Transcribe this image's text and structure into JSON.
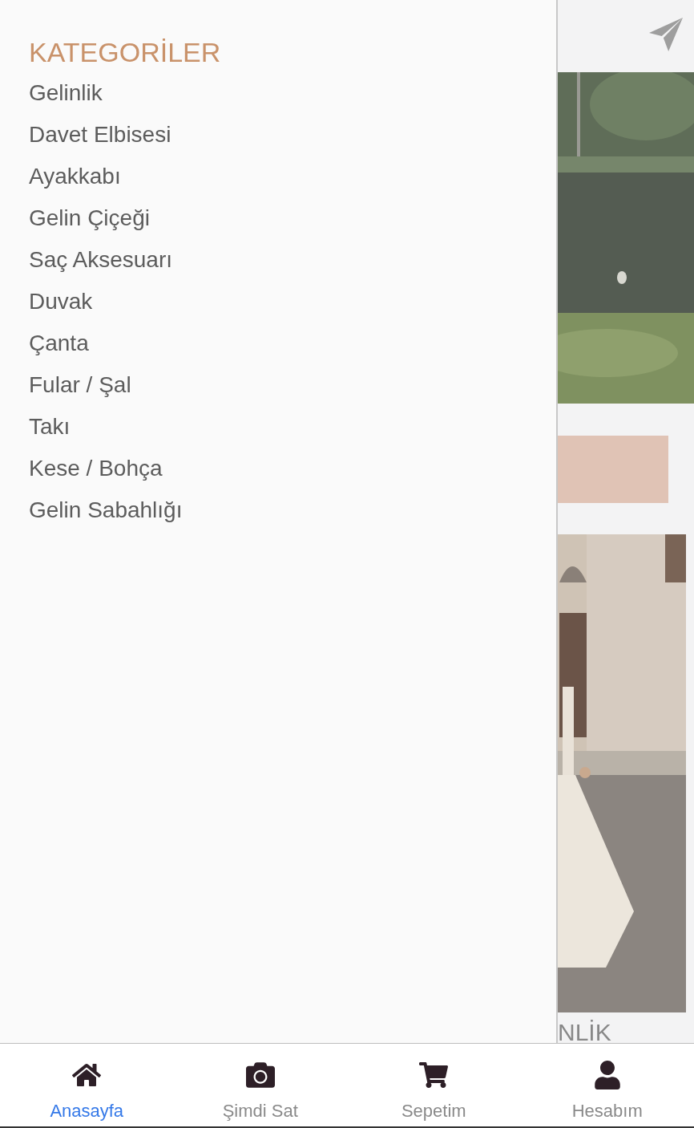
{
  "drawer": {
    "title": "KATEGORİLER",
    "categories": [
      "Gelinlik",
      "Davet Elbisesi",
      "Ayakkabı",
      "Gelin Çiçeği",
      "Saç Aksesuarı",
      "Duvak",
      "Çanta",
      "Fular / Şal",
      "Takı",
      "Kese / Bohça",
      "Gelin Sabahlığı"
    ]
  },
  "content": {
    "caption": "NLİK"
  },
  "bottom_nav": [
    {
      "label": "Anasayfa",
      "selected": true
    },
    {
      "label": "Şimdi Sat",
      "selected": false
    },
    {
      "label": "Sepetim",
      "selected": false
    },
    {
      "label": "Hesabım",
      "selected": false
    }
  ]
}
